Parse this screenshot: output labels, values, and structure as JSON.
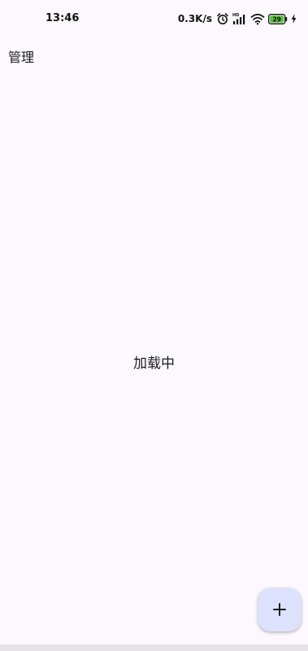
{
  "status_bar": {
    "time": "13:46",
    "net_speed": "0.3K/s",
    "battery_level": "29",
    "icons": [
      "alarm-icon",
      "hd-signal-icon",
      "wifi-icon",
      "battery-icon",
      "charging-icon"
    ]
  },
  "app_bar": {
    "title": "管理"
  },
  "main": {
    "loading_text": "加载中"
  },
  "fab": {
    "icon": "plus-icon",
    "background": "#dde1fb"
  },
  "colors": {
    "background": "#fcf8fd",
    "battery_fill": "#56c43a"
  }
}
